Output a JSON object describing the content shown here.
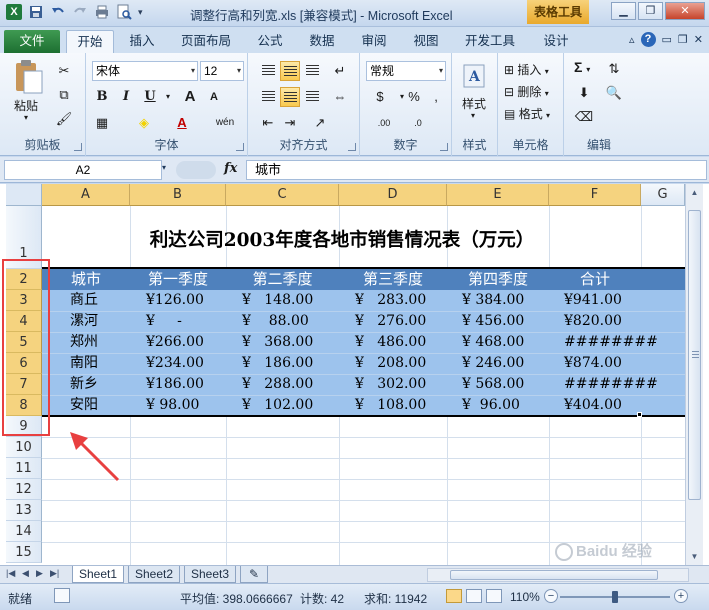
{
  "window": {
    "title": "调整行高和列宽.xls  [兼容模式] - Microsoft Excel",
    "context_tab": "表格工具",
    "icons": [
      "save-icon",
      "undo-icon",
      "redo-icon",
      "print-icon",
      "print-preview-icon",
      "qat-dropdown-icon"
    ],
    "controls": [
      "minimize",
      "restore",
      "close"
    ]
  },
  "ribbon_tabs": {
    "file": "文件",
    "tabs": [
      "开始",
      "插入",
      "页面布局",
      "公式",
      "数据",
      "审阅",
      "视图",
      "开发工具",
      "设计"
    ],
    "active": "开始"
  },
  "ribbon": {
    "clipboard": {
      "label": "剪贴板",
      "paste": "粘贴"
    },
    "font": {
      "label": "字体",
      "name": "宋体",
      "size": "12",
      "bold": "B",
      "italic": "I",
      "underline": "U",
      "grow": "A",
      "shrink": "A",
      "color_letter": "A",
      "phonetic": "wén"
    },
    "alignment": {
      "label": "对齐方式"
    },
    "number": {
      "label": "数字",
      "format": "常规",
      "currency": "$",
      "percent": "%",
      "comma": ",",
      "inc_decimal": ".00",
      "dec_decimal": ".0"
    },
    "styles": {
      "label": "样式",
      "name": "样式"
    },
    "cells": {
      "label": "单元格",
      "insert": "插入",
      "delete": "删除",
      "format": "格式"
    },
    "editing": {
      "label": "编辑",
      "sum": "Σ"
    }
  },
  "formula_bar": {
    "name_box": "A2",
    "fx": "fx",
    "content": "城市"
  },
  "sheet": {
    "columns": [
      "A",
      "B",
      "C",
      "D",
      "E",
      "F",
      "G"
    ],
    "rows": [
      "1",
      "2",
      "3",
      "4",
      "5",
      "6",
      "7",
      "8",
      "9",
      "10",
      "11",
      "12",
      "13",
      "14",
      "15"
    ],
    "title": "利达公司2003年度各地市销售情况表（万元）",
    "headers": [
      "城市",
      "第一季度",
      "第二季度",
      "第三季度",
      "第四季度",
      "合计"
    ],
    "data": [
      [
        "商丘",
        "¥126.00",
        "¥   148.00",
        "¥   283.00",
        "¥ 384.00",
        "¥941.00"
      ],
      [
        "漯河",
        "¥     -",
        "¥    88.00",
        "¥   276.00",
        "¥ 456.00",
        "¥820.00"
      ],
      [
        "郑州",
        "¥266.00",
        "¥   368.00",
        "¥   486.00",
        "¥ 468.00",
        "########"
      ],
      [
        "南阳",
        "¥234.00",
        "¥   186.00",
        "¥   208.00",
        "¥ 246.00",
        "¥874.00"
      ],
      [
        "新乡",
        "¥186.00",
        "¥   288.00",
        "¥   302.00",
        "¥ 568.00",
        "########"
      ],
      [
        "安阳",
        "¥ 98.00",
        "¥   102.00",
        "¥   108.00",
        "¥  96.00",
        "¥404.00"
      ]
    ],
    "annotation_color": "#e84040",
    "header_fill": "#4f81bd",
    "selection_fill": "#9dc3ed"
  },
  "sheet_tabs": [
    "Sheet1",
    "Sheet2",
    "Sheet3"
  ],
  "status": {
    "ready": "就绪",
    "average": "平均值: 398.0666667",
    "count": "计数: 42",
    "sum": "求和: 11942",
    "zoom": "110%",
    "zoom_out": "−",
    "zoom_in": "+"
  },
  "watermark": "Baidu 经验"
}
